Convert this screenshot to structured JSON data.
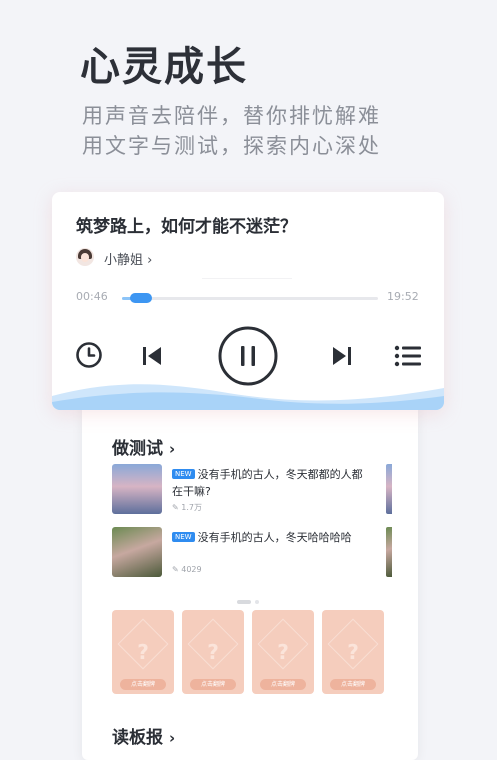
{
  "hero": {
    "title": "心灵成长",
    "subtitle_line1": "用声音去陪伴，替你排忧解难",
    "subtitle_line2": "用文字与测试，探索内心深处"
  },
  "player": {
    "song_title": "筑梦路上，如何才能不迷茫？",
    "author": "小静姐 ›",
    "current_time": "00:46",
    "total_time": "19:52",
    "progress": 0.06,
    "accent_color": "#3d96f2",
    "controls": [
      "timer-icon",
      "previous-icon",
      "pause-icon",
      "next-icon",
      "playlist-icon"
    ]
  },
  "quiz_section": {
    "title": "做测试",
    "chevron": "›",
    "items": [
      {
        "badge": "NEW",
        "title": "没有手机的古人，冬天都都的人都在干嘛?",
        "meta": "1.7万"
      },
      {
        "badge": "NEW",
        "title": "没有手机的古人，冬天哈哈哈哈",
        "meta": "4029"
      }
    ]
  },
  "tarot": {
    "cards": [
      {
        "symbol": "?",
        "button": "点击翻牌"
      },
      {
        "symbol": "?",
        "button": "点击翻牌"
      },
      {
        "symbol": "?",
        "button": "点击翻牌"
      },
      {
        "symbol": "?",
        "button": "点击翻牌"
      }
    ]
  },
  "read_section": {
    "title": "读板报",
    "chevron": "›"
  }
}
